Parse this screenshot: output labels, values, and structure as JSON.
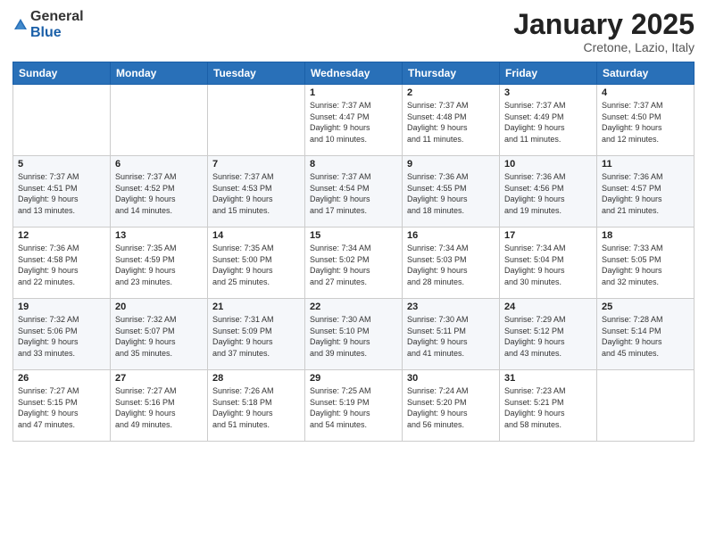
{
  "header": {
    "logo_general": "General",
    "logo_blue": "Blue",
    "month": "January 2025",
    "location": "Cretone, Lazio, Italy"
  },
  "weekdays": [
    "Sunday",
    "Monday",
    "Tuesday",
    "Wednesday",
    "Thursday",
    "Friday",
    "Saturday"
  ],
  "weeks": [
    [
      {
        "day": "",
        "info": ""
      },
      {
        "day": "",
        "info": ""
      },
      {
        "day": "",
        "info": ""
      },
      {
        "day": "1",
        "info": "Sunrise: 7:37 AM\nSunset: 4:47 PM\nDaylight: 9 hours\nand 10 minutes."
      },
      {
        "day": "2",
        "info": "Sunrise: 7:37 AM\nSunset: 4:48 PM\nDaylight: 9 hours\nand 11 minutes."
      },
      {
        "day": "3",
        "info": "Sunrise: 7:37 AM\nSunset: 4:49 PM\nDaylight: 9 hours\nand 11 minutes."
      },
      {
        "day": "4",
        "info": "Sunrise: 7:37 AM\nSunset: 4:50 PM\nDaylight: 9 hours\nand 12 minutes."
      }
    ],
    [
      {
        "day": "5",
        "info": "Sunrise: 7:37 AM\nSunset: 4:51 PM\nDaylight: 9 hours\nand 13 minutes."
      },
      {
        "day": "6",
        "info": "Sunrise: 7:37 AM\nSunset: 4:52 PM\nDaylight: 9 hours\nand 14 minutes."
      },
      {
        "day": "7",
        "info": "Sunrise: 7:37 AM\nSunset: 4:53 PM\nDaylight: 9 hours\nand 15 minutes."
      },
      {
        "day": "8",
        "info": "Sunrise: 7:37 AM\nSunset: 4:54 PM\nDaylight: 9 hours\nand 17 minutes."
      },
      {
        "day": "9",
        "info": "Sunrise: 7:36 AM\nSunset: 4:55 PM\nDaylight: 9 hours\nand 18 minutes."
      },
      {
        "day": "10",
        "info": "Sunrise: 7:36 AM\nSunset: 4:56 PM\nDaylight: 9 hours\nand 19 minutes."
      },
      {
        "day": "11",
        "info": "Sunrise: 7:36 AM\nSunset: 4:57 PM\nDaylight: 9 hours\nand 21 minutes."
      }
    ],
    [
      {
        "day": "12",
        "info": "Sunrise: 7:36 AM\nSunset: 4:58 PM\nDaylight: 9 hours\nand 22 minutes."
      },
      {
        "day": "13",
        "info": "Sunrise: 7:35 AM\nSunset: 4:59 PM\nDaylight: 9 hours\nand 23 minutes."
      },
      {
        "day": "14",
        "info": "Sunrise: 7:35 AM\nSunset: 5:00 PM\nDaylight: 9 hours\nand 25 minutes."
      },
      {
        "day": "15",
        "info": "Sunrise: 7:34 AM\nSunset: 5:02 PM\nDaylight: 9 hours\nand 27 minutes."
      },
      {
        "day": "16",
        "info": "Sunrise: 7:34 AM\nSunset: 5:03 PM\nDaylight: 9 hours\nand 28 minutes."
      },
      {
        "day": "17",
        "info": "Sunrise: 7:34 AM\nSunset: 5:04 PM\nDaylight: 9 hours\nand 30 minutes."
      },
      {
        "day": "18",
        "info": "Sunrise: 7:33 AM\nSunset: 5:05 PM\nDaylight: 9 hours\nand 32 minutes."
      }
    ],
    [
      {
        "day": "19",
        "info": "Sunrise: 7:32 AM\nSunset: 5:06 PM\nDaylight: 9 hours\nand 33 minutes."
      },
      {
        "day": "20",
        "info": "Sunrise: 7:32 AM\nSunset: 5:07 PM\nDaylight: 9 hours\nand 35 minutes."
      },
      {
        "day": "21",
        "info": "Sunrise: 7:31 AM\nSunset: 5:09 PM\nDaylight: 9 hours\nand 37 minutes."
      },
      {
        "day": "22",
        "info": "Sunrise: 7:30 AM\nSunset: 5:10 PM\nDaylight: 9 hours\nand 39 minutes."
      },
      {
        "day": "23",
        "info": "Sunrise: 7:30 AM\nSunset: 5:11 PM\nDaylight: 9 hours\nand 41 minutes."
      },
      {
        "day": "24",
        "info": "Sunrise: 7:29 AM\nSunset: 5:12 PM\nDaylight: 9 hours\nand 43 minutes."
      },
      {
        "day": "25",
        "info": "Sunrise: 7:28 AM\nSunset: 5:14 PM\nDaylight: 9 hours\nand 45 minutes."
      }
    ],
    [
      {
        "day": "26",
        "info": "Sunrise: 7:27 AM\nSunset: 5:15 PM\nDaylight: 9 hours\nand 47 minutes."
      },
      {
        "day": "27",
        "info": "Sunrise: 7:27 AM\nSunset: 5:16 PM\nDaylight: 9 hours\nand 49 minutes."
      },
      {
        "day": "28",
        "info": "Sunrise: 7:26 AM\nSunset: 5:18 PM\nDaylight: 9 hours\nand 51 minutes."
      },
      {
        "day": "29",
        "info": "Sunrise: 7:25 AM\nSunset: 5:19 PM\nDaylight: 9 hours\nand 54 minutes."
      },
      {
        "day": "30",
        "info": "Sunrise: 7:24 AM\nSunset: 5:20 PM\nDaylight: 9 hours\nand 56 minutes."
      },
      {
        "day": "31",
        "info": "Sunrise: 7:23 AM\nSunset: 5:21 PM\nDaylight: 9 hours\nand 58 minutes."
      },
      {
        "day": "",
        "info": ""
      }
    ]
  ]
}
